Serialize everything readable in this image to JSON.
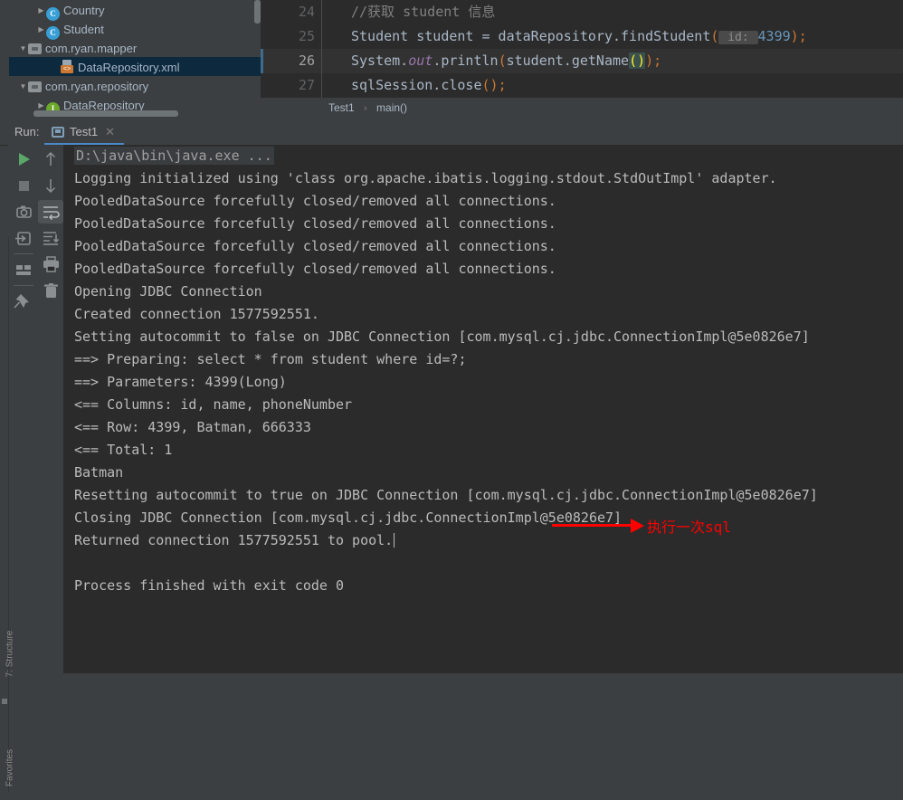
{
  "project_tree": {
    "name": "project-tree",
    "items": [
      {
        "label": "Country",
        "icon": "class-icon",
        "arrow": "collapsed",
        "indent": 52,
        "selected": false
      },
      {
        "label": "Student",
        "icon": "class-icon",
        "arrow": "collapsed",
        "indent": 52,
        "selected": false
      },
      {
        "label": "com.ryan.mapper",
        "icon": "package-icon",
        "arrow": "expanded",
        "indent": 32,
        "selected": false
      },
      {
        "label": "DataRepository.xml",
        "icon": "xml-file-icon",
        "arrow": "none",
        "indent": 68,
        "selected": true
      },
      {
        "label": "com.ryan.repository",
        "icon": "package-icon",
        "arrow": "expanded",
        "indent": 32,
        "selected": false
      },
      {
        "label": "DataRepository",
        "icon": "interface-icon",
        "arrow": "collapsed",
        "indent": 52,
        "selected": false
      }
    ]
  },
  "editor": {
    "lines": [
      {
        "number": "24",
        "current": false,
        "tokens": [
          {
            "text": "    //获取 student 信息",
            "cls": "tok-comment"
          }
        ]
      },
      {
        "number": "25",
        "current": false,
        "tokens": [
          {
            "text": "    Student student = dataRepository.findStudent",
            "cls": "tok-plain"
          },
          {
            "text": "(",
            "cls": "tok-paren"
          },
          {
            "text": " id: ",
            "cls": "hint-chip"
          },
          {
            "text": "4399",
            "cls": "tok-num"
          },
          {
            "text": ")",
            "cls": "tok-paren"
          },
          {
            "text": ";",
            "cls": "tok-semi"
          }
        ]
      },
      {
        "number": "26",
        "current": true,
        "tokens": [
          {
            "text": "    System.",
            "cls": "tok-plain"
          },
          {
            "text": "out",
            "cls": "tok-static"
          },
          {
            "text": ".println",
            "cls": "tok-plain"
          },
          {
            "text": "(",
            "cls": "tok-paren"
          },
          {
            "text": "student.getName",
            "cls": "tok-plain"
          },
          {
            "text": "()",
            "cls": "match-brace"
          },
          {
            "text": ")",
            "cls": "tok-paren"
          },
          {
            "text": ";",
            "cls": "tok-semi"
          }
        ]
      },
      {
        "number": "27",
        "current": false,
        "tokens": [
          {
            "text": "    sqlSession.close",
            "cls": "tok-plain"
          },
          {
            "text": "()",
            "cls": "tok-paren"
          },
          {
            "text": ";",
            "cls": "tok-semi"
          }
        ]
      }
    ],
    "breadcrumb": {
      "class": "Test1",
      "separator": "›",
      "method": "main()"
    }
  },
  "run_panel": {
    "label": "Run:",
    "tab": {
      "title": "Test1",
      "close": "✕",
      "icon": "run-config-icon"
    },
    "toolbar_left": [
      {
        "name": "rerun-button",
        "icon": "play-icon"
      },
      {
        "name": "stop-button",
        "icon": "stop-icon"
      },
      {
        "name": "dump-threads-button",
        "icon": "camera-icon"
      },
      {
        "name": "restore-layout-button",
        "icon": "restore-icon"
      },
      {
        "name": "layout-button",
        "icon": "layout-icon"
      },
      {
        "name": "pin-tab-button",
        "icon": "pin-icon"
      }
    ],
    "toolbar_right": [
      {
        "name": "up-the-stack-trace-button",
        "icon": "arrow-up-icon"
      },
      {
        "name": "down-the-stack-trace-button",
        "icon": "arrow-down-icon"
      },
      {
        "name": "soft-wrap-button",
        "icon": "soft-wrap-icon",
        "active": true
      },
      {
        "name": "scroll-to-end-button",
        "icon": "scroll-to-end-icon"
      },
      {
        "name": "print-button",
        "icon": "printer-icon"
      },
      {
        "name": "clear-all-button",
        "icon": "trash-icon"
      }
    ]
  },
  "console": {
    "command_line": "D:\\java\\bin\\java.exe ...",
    "lines": [
      "Logging initialized using 'class org.apache.ibatis.logging.stdout.StdOutImpl' adapter.",
      "PooledDataSource forcefully closed/removed all connections.",
      "PooledDataSource forcefully closed/removed all connections.",
      "PooledDataSource forcefully closed/removed all connections.",
      "PooledDataSource forcefully closed/removed all connections.",
      "Opening JDBC Connection",
      "Created connection 1577592551.",
      "Setting autocommit to false on JDBC Connection [com.mysql.cj.jdbc.ConnectionImpl@5e0826e7]",
      "==>  Preparing: select * from student where id=?;",
      "==> Parameters: 4399(Long)",
      "<==    Columns: id, name, phoneNumber",
      "<==        Row: 4399, Batman, 666333",
      "<==      Total: 1",
      "Batman",
      "Resetting autocommit to true on JDBC Connection [com.mysql.cj.jdbc.ConnectionImpl@5e0826e7]",
      "Closing JDBC Connection [com.mysql.cj.jdbc.ConnectionImpl@5e0826e7]",
      "Returned connection 1577592551 to pool."
    ],
    "exit_line": "Process finished with exit code 0"
  },
  "annotations": [
    {
      "name": "sql-executed-once-note",
      "text": "执行一次sql",
      "color": "#ff0000"
    }
  ],
  "side_tool_windows": [
    {
      "label": "7: Structure",
      "name": "tool-window-structure"
    },
    {
      "label": "Favorites",
      "name": "tool-window-favorites"
    }
  ]
}
